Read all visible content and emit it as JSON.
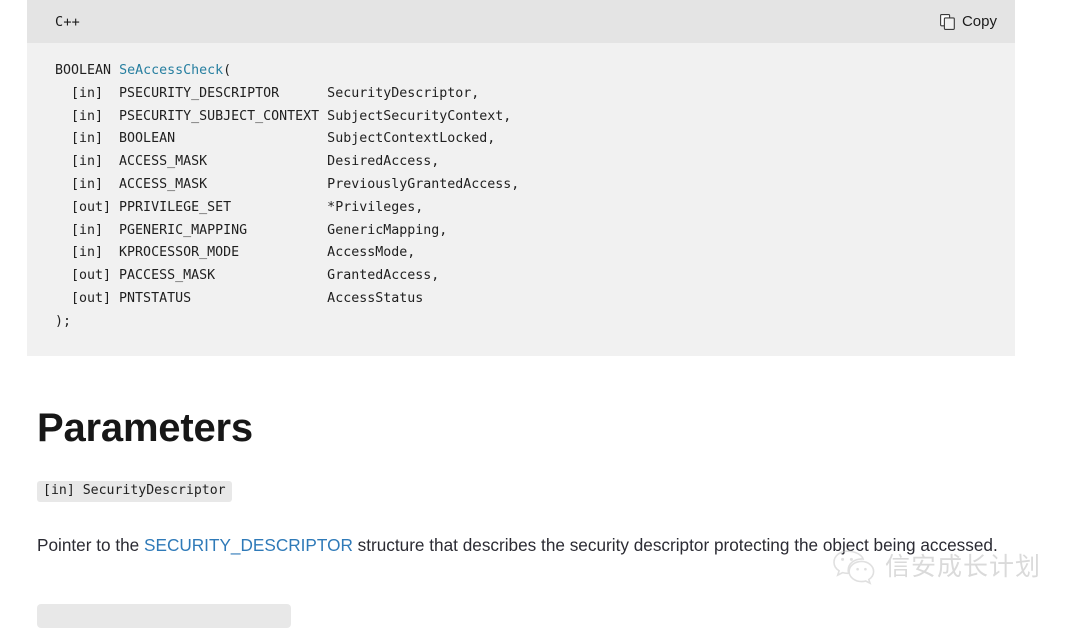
{
  "code_block": {
    "language_label": "C++",
    "copy_label": "Copy",
    "copy_icon": "copy-icon",
    "signature_return": "BOOLEAN",
    "signature_function": "SeAccessCheck",
    "open_paren": "(",
    "close": ");",
    "parameters": [
      {
        "direction": "[in]",
        "type": "PSECURITY_DESCRIPTOR",
        "name": "SecurityDescriptor,"
      },
      {
        "direction": "[in]",
        "type": "PSECURITY_SUBJECT_CONTEXT",
        "name": "SubjectSecurityContext,"
      },
      {
        "direction": "[in]",
        "type": "BOOLEAN",
        "name": "SubjectContextLocked,"
      },
      {
        "direction": "[in]",
        "type": "ACCESS_MASK",
        "name": "DesiredAccess,"
      },
      {
        "direction": "[in]",
        "type": "ACCESS_MASK",
        "name": "PreviouslyGrantedAccess,"
      },
      {
        "direction": "[out]",
        "type": "PPRIVILEGE_SET",
        "name": "*Privileges,"
      },
      {
        "direction": "[in]",
        "type": "PGENERIC_MAPPING",
        "name": "GenericMapping,"
      },
      {
        "direction": "[in]",
        "type": "KPROCESSOR_MODE",
        "name": "AccessMode,"
      },
      {
        "direction": "[out]",
        "type": "PACCESS_MASK",
        "name": "GrantedAccess,"
      },
      {
        "direction": "[out]",
        "type": "PNTSTATUS",
        "name": "AccessStatus"
      }
    ]
  },
  "parameters_section": {
    "heading": "Parameters",
    "first_param": {
      "badge": "[in] SecurityDescriptor",
      "description_before_link": "Pointer to the ",
      "link_text": "SECURITY_DESCRIPTOR",
      "description_after_link": " structure that describes the security descriptor protecting the object being accessed."
    }
  },
  "watermark": {
    "logo_icon": "wechat-logo-icon",
    "text": "信安成长计划"
  },
  "colors": {
    "code_header_bg": "#e4e4e4",
    "code_body_bg": "#f1f1f1",
    "function_name": "#277fa0",
    "link": "#2f7ab8",
    "badge_bg": "#e8e8e8",
    "text": "#171717",
    "watermark": "#b9b9b9"
  }
}
